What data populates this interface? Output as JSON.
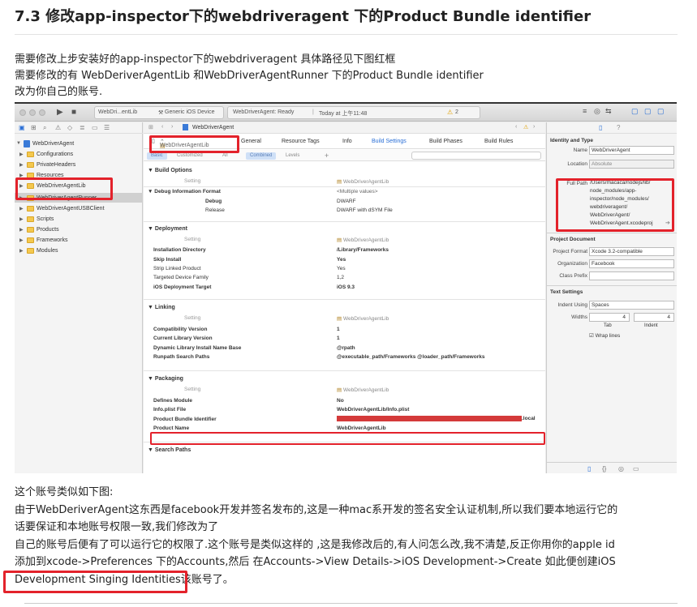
{
  "heading": "7.3 修改app-inspector下的webdriveragent 下的Product Bundle identifier",
  "intro": [
    "需要修改上步安装好的app-inspector下的webdriveragent 具体路径见下图红框",
    "需要修改的有 WebDeriverAgentLib 和WebDriverAgentRunner 下的Product Bundle identifier",
    "改为你自己的账号."
  ],
  "outro": [
    "这个账号类似如下图:",
    "由于WebDeriverAgent这东西是facebook开发并签名发布的,这是一种mac系开发的签名安全认证机制,所以我们要本地运行它的",
    "话要保证和本地账号权限一致,我们修改为了",
    "自己的账号后便有了可以运行它的权限了.这个账号是类似这样的 ,这是我修改后的,有人问怎么改,我不清楚,反正你用你的apple id",
    "添加到xcode->Preferences 下的Accounts,然后 在Accounts->View Details->iOS Development->Create 如此便创建iOS",
    "Development Singing Identities该账号了。"
  ],
  "xcode": {
    "toolbar": {
      "scheme": "WebDri...entLib",
      "device": "Generic iOS Device",
      "status": "WebDriverAgent: Ready",
      "time": "Today at 上午11:48",
      "warnings": "2"
    },
    "navigator": {
      "items": [
        {
          "label": "WebDriverAgent",
          "level": 0
        },
        {
          "label": "Configurations",
          "level": 1
        },
        {
          "label": "PrivateHeaders",
          "level": 1
        },
        {
          "label": "Resources",
          "level": 1
        },
        {
          "label": "WebDriverAgentLib",
          "level": 1
        },
        {
          "label": "WebDriverAgentRunner",
          "level": 1
        },
        {
          "label": "WebDriverAgentUSBClient",
          "level": 1
        },
        {
          "label": "Scripts",
          "level": 1
        },
        {
          "label": "Products",
          "level": 1
        },
        {
          "label": "Frameworks",
          "level": 1
        },
        {
          "label": "Modules",
          "level": 1
        }
      ]
    },
    "editor": {
      "breadcrumb": "WebDriverAgent",
      "target": "WebDriverAgentLib",
      "tabs": [
        "General",
        "Resource Tags",
        "Info",
        "Build Settings",
        "Build Phases",
        "Build Rules"
      ],
      "filters": [
        "Basic",
        "Customized",
        "All",
        "Combined",
        "Levels"
      ],
      "setting_col": "Setting",
      "target_col": "WebDriverAgentLib",
      "sections": {
        "build_options": "Build Options",
        "debug_info": "Debug Information Format",
        "multiple": "<Multiple values>",
        "debug": "Debug",
        "debug_val": "DWARF",
        "release": "Release",
        "release_val": "DWARF with dSYM File",
        "deployment": "Deployment",
        "install_dir": "Installation Directory",
        "install_dir_val": "/Library/Frameworks",
        "skip_install": "Skip Install",
        "yes": "Yes",
        "strip": "Strip Linked Product",
        "targeted": "Targeted Device Family",
        "targeted_val": "1,2",
        "ios_target": "iOS Deployment Target",
        "ios_target_val": "iOS 9.3",
        "linking": "Linking",
        "compat": "Compatibility Version",
        "current": "Current Library Version",
        "one": "1",
        "dyld": "Dynamic Library Install Name Base",
        "dyld_val": "@rpath",
        "runpath": "Runpath Search Paths",
        "runpath_val": "@executable_path/Frameworks @loader_path/Frameworks",
        "packaging": "Packaging",
        "defines": "Defines Module",
        "no": "No",
        "infoplist": "Info.plist File",
        "infoplist_val": "WebDriverAgentLib/Info.plist",
        "pbi": "Product Bundle Identifier",
        "pbi_suffix": ".local",
        "pname": "Product Name",
        "pname_val": "WebDriverAgentLib",
        "search": "Search Paths"
      }
    },
    "inspector": {
      "identity": "Identity and Type",
      "name_k": "Name",
      "name_v": "WebDriverAgent",
      "location_k": "Location",
      "location_v": "Absolute",
      "fullpath_k": "Full Path",
      "fullpath_lines": [
        "/Users/macaca/nodejs/lib/",
        "node_modules/app-",
        "inspector/node_modules/",
        "webdriveragent/",
        "WebDriverAgent/",
        "WebDriverAgent.xcodeproj"
      ],
      "project_doc": "Project Document",
      "pformat_k": "Project Format",
      "pformat_v": "Xcode 3.2-compatible",
      "org_k": "Organization",
      "org_v": "Facebook",
      "prefix_k": "Class Prefix",
      "text_settings": "Text Settings",
      "indent_k": "Indent Using",
      "indent_v": "Spaces",
      "widths_k": "Widths",
      "tab_v": "4",
      "indent_n": "4",
      "tab_lbl": "Tab",
      "indent_lbl": "Indent",
      "wrap": "Wrap lines"
    }
  }
}
